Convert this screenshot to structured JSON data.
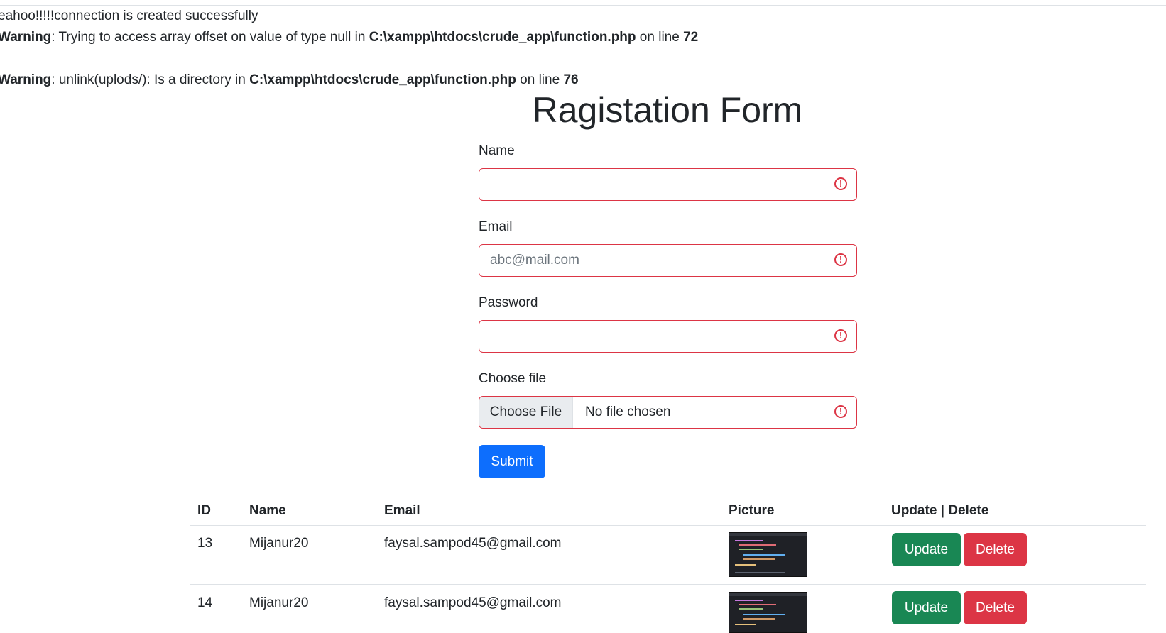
{
  "messages": {
    "connection": "eahoo!!!!!connection is created successfully",
    "warning1": {
      "label": "Warning",
      "text_a": ": Trying to access array offset on value of type null in ",
      "path": "C:\\xampp\\htdocs\\crude_app\\function.php",
      "text_b": " on line ",
      "line": "72"
    },
    "warning2": {
      "label": "Warning",
      "text_a": ": unlink(uplods/): Is a directory in ",
      "path": "C:\\xampp\\htdocs\\crude_app\\function.php",
      "text_b": " on line ",
      "line": "76"
    }
  },
  "form": {
    "title": "Ragistation Form",
    "name_label": "Name",
    "name_value": "",
    "email_label": "Email",
    "email_placeholder": "abc@mail.com",
    "password_label": "Password",
    "file_label": "Choose file",
    "file_button": "Choose File",
    "file_status": "No file chosen",
    "submit_label": "Submit",
    "error_color": "#dc3545",
    "primary_color": "#0d6efd"
  },
  "table": {
    "headers": [
      "ID",
      "Name",
      "Email",
      "Picture",
      "Update | Delete"
    ],
    "rows": [
      {
        "id": "13",
        "name": "Mijanur20",
        "email": "faysal.sampod45@gmail.com",
        "picture": "code-screenshot-thumbnail",
        "update": "Update",
        "delete": "Delete"
      },
      {
        "id": "14",
        "name": "Mijanur20",
        "email": "faysal.sampod45@gmail.com",
        "picture": "code-screenshot-thumbnail",
        "update": "Update",
        "delete": "Delete"
      }
    ],
    "update_color": "#198754",
    "delete_color": "#dc3545"
  }
}
